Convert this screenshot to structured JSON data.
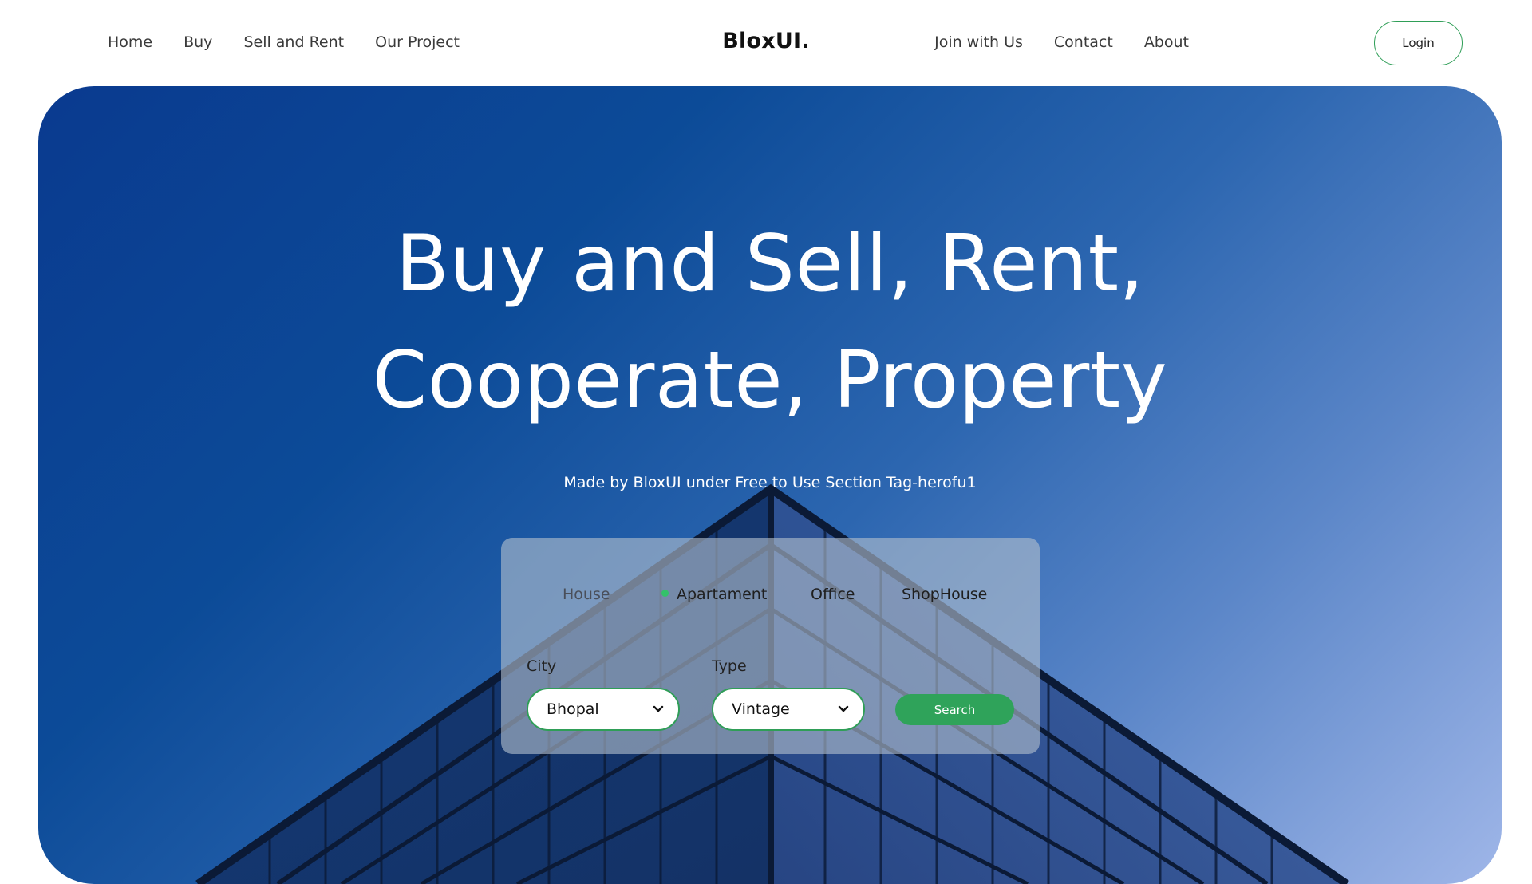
{
  "nav": {
    "left_links": [
      "Home",
      "Buy",
      "Sell and Rent",
      "Our Project"
    ],
    "brand": "BloxUI.",
    "right_links": [
      "Join with Us",
      "Contact",
      "About"
    ],
    "login_label": "Login"
  },
  "hero": {
    "headline_line1": "Buy and Sell, Rent,",
    "headline_line2": "Cooperate, Property",
    "subline": "Made by BloxUI under Free to Use Section Tag-herofu1"
  },
  "search": {
    "tabs": [
      {
        "label": "House",
        "active": false
      },
      {
        "label": "Apartament",
        "active": true
      },
      {
        "label": "Office",
        "active": false
      },
      {
        "label": "ShopHouse",
        "active": false
      }
    ],
    "city_label": "City",
    "city_value": "Bhopal",
    "type_label": "Type",
    "type_value": "Vintage",
    "search_label": "Search"
  },
  "colors": {
    "accent": "#2fa35a",
    "active_dot": "#34c26a",
    "hero_gradient_start": "#0a3a8f",
    "hero_gradient_end": "#9fb6e8"
  },
  "icons": {
    "select_chevron": "chevron-down-icon"
  }
}
